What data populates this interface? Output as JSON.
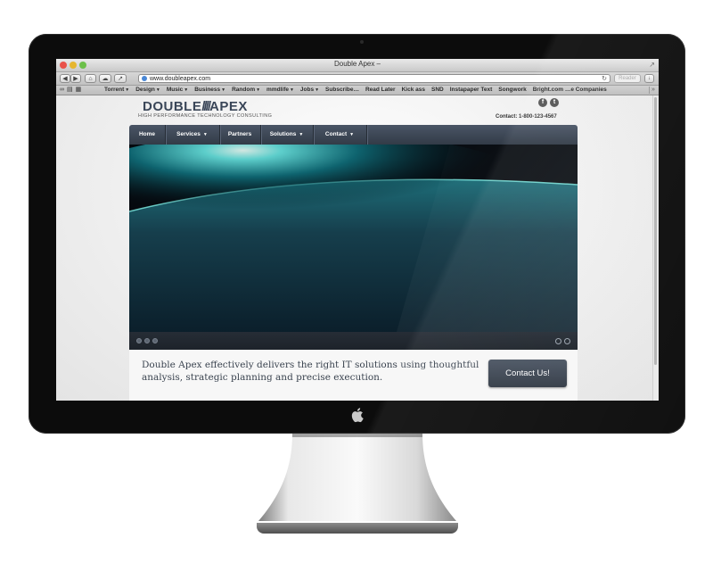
{
  "window": {
    "title": "Double Apex –"
  },
  "toolbar": {
    "url": "www.doubleapex.com",
    "reader_label": "Reader"
  },
  "bookmarks": [
    {
      "label": "Torrent",
      "dropdown": true
    },
    {
      "label": "Design",
      "dropdown": true
    },
    {
      "label": "Music",
      "dropdown": true
    },
    {
      "label": "Business",
      "dropdown": true
    },
    {
      "label": "Random",
      "dropdown": true
    },
    {
      "label": "mmdlife",
      "dropdown": true
    },
    {
      "label": "Jobs",
      "dropdown": true
    },
    {
      "label": "Subscribe…",
      "dropdown": false
    },
    {
      "label": "Read Later",
      "dropdown": false
    },
    {
      "label": "Kick ass",
      "dropdown": false
    },
    {
      "label": "SND",
      "dropdown": false
    },
    {
      "label": "Instapaper Text",
      "dropdown": false
    },
    {
      "label": "Songwork",
      "dropdown": false
    },
    {
      "label": "Bright.com …e Companies",
      "dropdown": false
    }
  ],
  "site": {
    "logo_left": "DOUBLE",
    "logo_slash": "////",
    "logo_right": "APEX",
    "tagline": "HIGH PERFORMANCE TECHNOLOGY CONSULTING",
    "social": {
      "facebook": "f",
      "twitter": "t"
    },
    "contact_phone": "Contact: 1-800-123-4567",
    "nav": [
      {
        "label": "Home",
        "dropdown": false
      },
      {
        "label": "Services",
        "dropdown": true
      },
      {
        "label": "Partners",
        "dropdown": false
      },
      {
        "label": "Solutions",
        "dropdown": true
      },
      {
        "label": "Contact",
        "dropdown": true
      }
    ],
    "hero_slides": 3,
    "callout_text": "Double Apex effectively delivers the right IT solutions using thoughtful analysis, strategic planning and precise execution.",
    "cta_label": "Contact Us!"
  },
  "colors": {
    "nav_background": "#3a4452",
    "cta_background": "#404957",
    "logo_color": "#3a4658",
    "earth_glow": "#3fd0d8"
  }
}
